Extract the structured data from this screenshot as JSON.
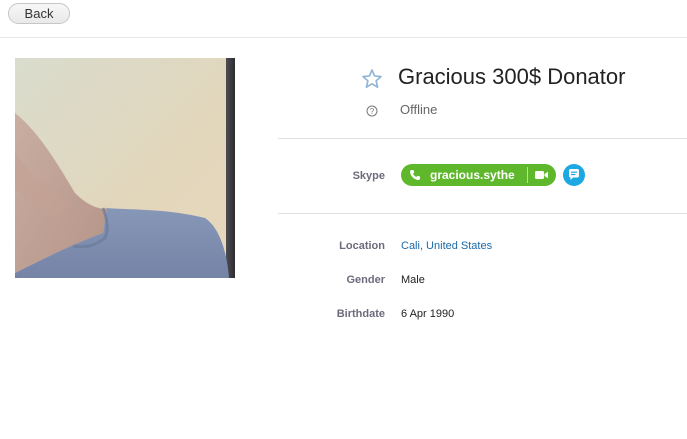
{
  "toolbar": {
    "back_label": "Back"
  },
  "profile": {
    "display_name": "Gracious 300$ Donator",
    "status": "Offline",
    "favorite_icon": "star-outline-icon",
    "status_icon": "question-circle-icon"
  },
  "contact": {
    "skype_label": "Skype",
    "skype_handle": "gracious.sythe",
    "call_icon": "phone-icon",
    "video_icon": "video-camera-icon",
    "chat_icon": "chat-bubble-icon"
  },
  "details": [
    {
      "label": "Location",
      "value": "Cali, United States"
    },
    {
      "label": "Gender",
      "value": "Male"
    },
    {
      "label": "Birthdate",
      "value": "6 Apr 1990"
    }
  ],
  "colors": {
    "skype_green": "#5fb82b",
    "chat_blue": "#1ca9e1",
    "link": "#1a6aa8"
  }
}
